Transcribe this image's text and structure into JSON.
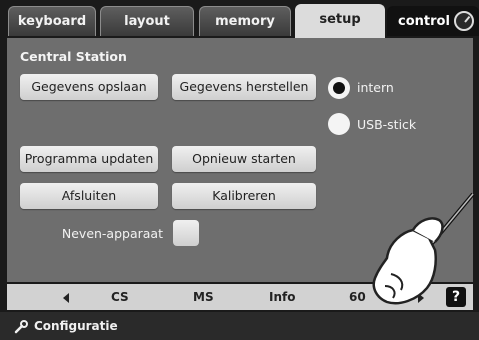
{
  "tabs": [
    {
      "label": "keyboard"
    },
    {
      "label": "layout"
    },
    {
      "label": "memory"
    },
    {
      "label": "setup"
    },
    {
      "label": "control"
    }
  ],
  "panel": {
    "title": "Central Station",
    "buttons": {
      "save": "Gegevens opslaan",
      "restore": "Gegevens herstellen",
      "update": "Programma updaten",
      "restart": "Opnieuw starten",
      "close": "Afsluiten",
      "calibrate": "Kalibreren"
    },
    "storage": {
      "intern": "intern",
      "usb": "USB-stick",
      "selected": "intern"
    },
    "secondary": {
      "label": "Neven-apparaat",
      "checked": false
    }
  },
  "navbar": {
    "items": [
      "CS",
      "MS",
      "Info",
      "60"
    ],
    "help": "?"
  },
  "footer": {
    "label": "Configuratie"
  }
}
